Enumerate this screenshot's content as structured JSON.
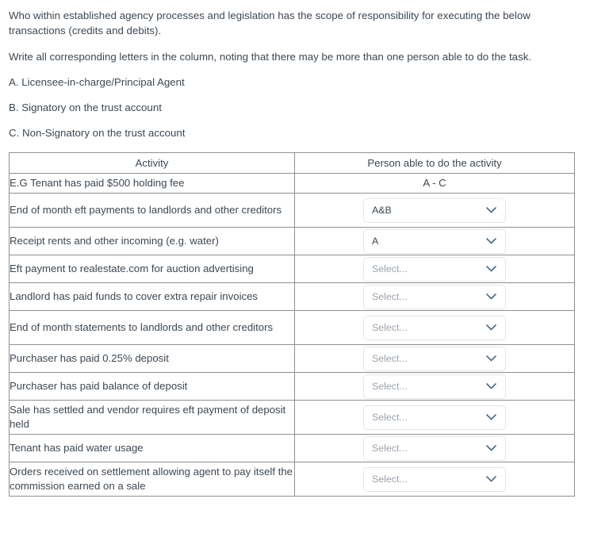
{
  "intro": {
    "paragraph1": "Who within established agency processes and legislation has the scope of responsibility for executing the below transactions (credits and debits).",
    "paragraph2": "Write all corresponding letters in the column, noting that there may be more than one person able to do the task.",
    "options": [
      "A. Licensee-in-charge/Principal Agent",
      "B. Signatory on the trust account",
      "C. Non-Signatory on the trust account"
    ]
  },
  "table": {
    "headers": {
      "activity": "Activity",
      "person": "Person able to do the activity"
    },
    "example_row": {
      "activity": "E.G Tenant has paid $500 holding fee",
      "person": "A - C"
    },
    "placeholder": "Select...",
    "rows": [
      {
        "activity": "End of month eft payments to landlords and other creditors",
        "value": "A&B",
        "is_placeholder": false
      },
      {
        "activity": "Receipt rents and other incoming (e.g. water)",
        "value": "A",
        "is_placeholder": false
      },
      {
        "activity": "Eft payment to realestate.com for auction advertising",
        "value": "Select...",
        "is_placeholder": true
      },
      {
        "activity": "Landlord has paid funds to cover extra repair invoices",
        "value": "Select...",
        "is_placeholder": true
      },
      {
        "activity": "End of month statements to landlords and other creditors",
        "value": "Select...",
        "is_placeholder": true
      },
      {
        "activity": "Purchaser has paid 0.25% deposit",
        "value": "Select...",
        "is_placeholder": true
      },
      {
        "activity": "Purchaser has paid balance of deposit",
        "value": "Select...",
        "is_placeholder": true
      },
      {
        "activity": "Sale has settled and vendor requires eft payment of deposit held",
        "value": "Select...",
        "is_placeholder": true
      },
      {
        "activity": "Tenant has paid water usage",
        "value": "Select...",
        "is_placeholder": true
      },
      {
        "activity": "Orders received on settlement allowing agent to pay itself the commission earned on a sale",
        "value": "Select...",
        "is_placeholder": true
      }
    ]
  },
  "icons": {
    "dropdown": "chevron-down-icon"
  },
  "colors": {
    "text": "#3d4852",
    "table_border": "#8f8f8f",
    "select_border": "#e2e5e8",
    "placeholder_text": "#9aa2ab",
    "background": "#ffffff"
  }
}
